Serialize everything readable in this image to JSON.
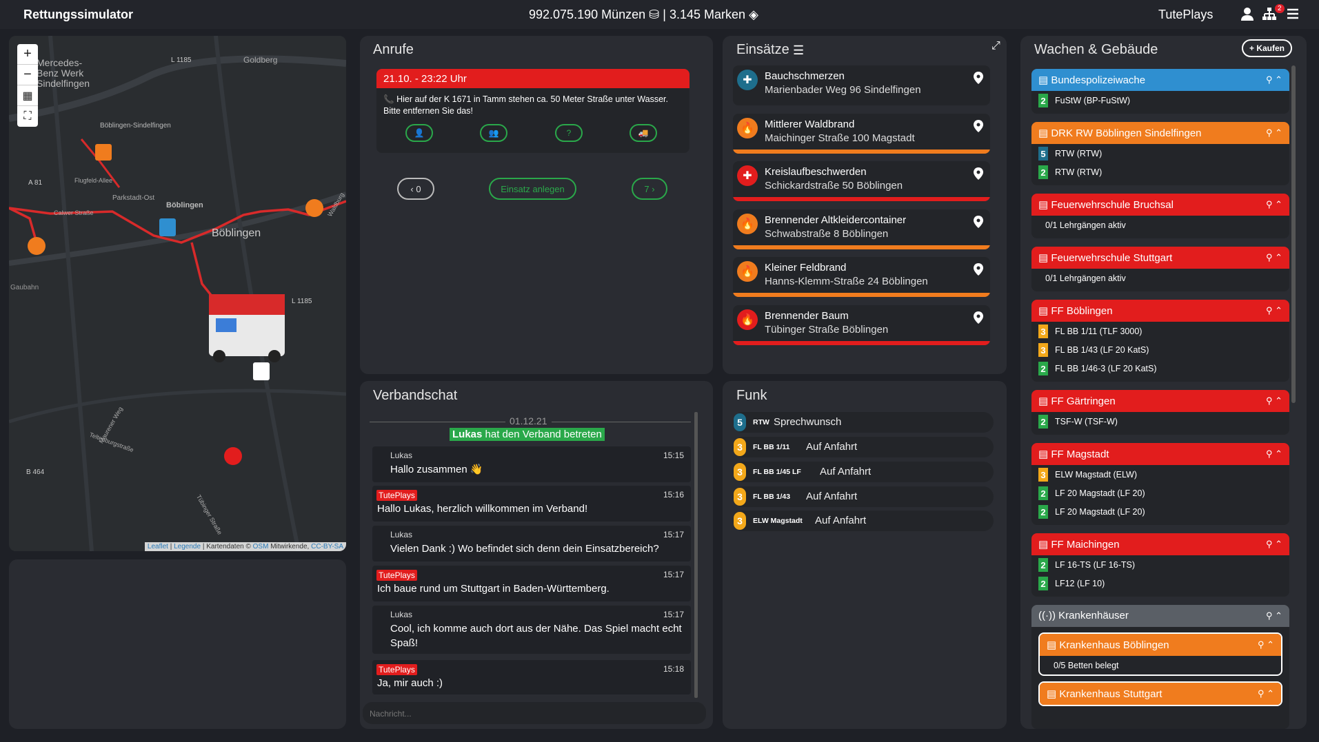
{
  "app": {
    "title": "Rettungssimulator",
    "currency": "992.075.190 Münzen",
    "separator": "|",
    "marks": "3.145 Marken",
    "user": "TutePlays",
    "notifications": "2"
  },
  "map": {
    "labels": [
      "Mercedes-",
      "Benz Werk",
      "Sindelfingen",
      "L 1185",
      "Goldberg",
      "Böblingen-Sindelfingen",
      "A 81",
      "Flugfeld-Allee",
      "Parkstadt-Ost",
      "Böblingen",
      "Calwer Straße",
      "Böblingen",
      "L 1185",
      "Gaubahn",
      "Waldburg",
      "Maurener Weg",
      "Teltenburgstraße",
      "B 464",
      "Tübinger Straße"
    ],
    "attribution": {
      "leaflet": "Leaflet",
      "legend": "Legende",
      "data": "Kartendaten ©",
      "osm": "OSM",
      "contrib": "Mitwirkende,",
      "license": "CC-BY-SA",
      "sep": "|"
    },
    "zoom_in": "+",
    "zoom_out": "−"
  },
  "calls": {
    "title": "Anrufe",
    "current": {
      "time": "21.10. - 23:22 Uhr",
      "text": "Hier auf der K 1671 in Tamm stehen ca. 50 Meter Straße unter Wasser. Bitte entfernen Sie das!"
    },
    "prev": "‹ 0",
    "create": "Einsatz anlegen",
    "next": "7 ›"
  },
  "missions": {
    "title": "Einsätze",
    "items": [
      {
        "name": "Bauchschmerzen",
        "address": "Marienbader Weg 96 Sindelfingen",
        "color": "#1e6e8c",
        "bar": ""
      },
      {
        "name": "Mittlerer Waldbrand",
        "address": "Maichinger Straße 100 Magstadt",
        "color": "#f07c1e",
        "bar": "#f07c1e"
      },
      {
        "name": "Kreislaufbeschwerden",
        "address": "Schickardstraße 50 Böblingen",
        "color": "#e21d1d",
        "bar": "#e21d1d"
      },
      {
        "name": "Brennender Altkleidercontainer",
        "address": "Schwabstraße 8 Böblingen",
        "color": "#f07c1e",
        "bar": "#f07c1e"
      },
      {
        "name": "Kleiner Feldbrand",
        "address": "Hanns-Klemm-Straße 24 Böblingen",
        "color": "#f07c1e",
        "bar": "#f07c1e"
      },
      {
        "name": "Brennender Baum",
        "address": "Tübinger Straße Böblingen",
        "color": "#e21d1d",
        "bar": "#e21d1d"
      }
    ]
  },
  "chat": {
    "title": "Verbandschat",
    "date": "01.12.21",
    "join_name": "Lukas",
    "join_text": "hat den Verband betreten",
    "messages": [
      {
        "user": "Lukas",
        "time": "15:15",
        "text": "Hallo zusammen 👋"
      },
      {
        "user": "TutePlays",
        "time": "15:16",
        "text": "Hallo Lukas, herzlich willkommen im Verband!"
      },
      {
        "user": "Lukas",
        "time": "15:17",
        "text": "Vielen Dank :) Wo befindet sich denn dein Einsatzbereich?"
      },
      {
        "user": "TutePlays",
        "time": "15:17",
        "text": "Ich baue rund um Stuttgart in Baden-Württemberg."
      },
      {
        "user": "Lukas",
        "time": "15:17",
        "text": "Cool, ich komme auch dort aus der Nähe. Das Spiel macht echt Spaß!"
      },
      {
        "user": "TutePlays",
        "time": "15:18",
        "text": "Ja, mir auch :)"
      }
    ],
    "placeholder": "Nachricht..."
  },
  "funk": {
    "title": "Funk",
    "items": [
      {
        "status": "5",
        "color": "#1e6e8c",
        "vehicle": "RTW",
        "message": "Sprechwunsch"
      },
      {
        "status": "3",
        "color": "#f3a81a",
        "vehicle": "FL BB 1/11",
        "message": "Auf Anfahrt"
      },
      {
        "status": "3",
        "color": "#f3a81a",
        "vehicle": "FL BB 1/45 LF",
        "message": "Auf Anfahrt"
      },
      {
        "status": "3",
        "color": "#f3a81a",
        "vehicle": "FL BB 1/43",
        "message": "Auf Anfahrt"
      },
      {
        "status": "3",
        "color": "#f3a81a",
        "vehicle": "ELW Magstadt",
        "message": "Auf Anfahrt"
      }
    ]
  },
  "stations": {
    "title": "Wachen & Gebäude",
    "buy": "+ Kaufen",
    "items": [
      {
        "name": "Bundespolizeiwache",
        "color": "#2f8fd0",
        "lines": [
          {
            "status": "2",
            "text": "FuStW (BP-FuStW)"
          }
        ]
      },
      {
        "name": "DRK RW Böblingen Sindelfingen",
        "color": "#f07c1e",
        "lines": [
          {
            "status": "5",
            "text": "RTW (RTW)"
          },
          {
            "status": "2",
            "text": "RTW (RTW)"
          }
        ]
      },
      {
        "name": "Feuerwehrschule Bruchsal",
        "color": "#e21d1d",
        "lines": [
          {
            "status": "",
            "text": "0/1 Lehrgängen aktiv"
          }
        ]
      },
      {
        "name": "Feuerwehrschule Stuttgart",
        "color": "#e21d1d",
        "lines": [
          {
            "status": "",
            "text": "0/1 Lehrgängen aktiv"
          }
        ]
      },
      {
        "name": "FF Böblingen",
        "color": "#e21d1d",
        "lines": [
          {
            "status": "3",
            "text": "FL BB 1/11 (TLF 3000)"
          },
          {
            "status": "3",
            "text": "FL BB 1/43 (LF 20 KatS)"
          },
          {
            "status": "2",
            "text": "FL BB 1/46-3 (LF 20 KatS)"
          }
        ]
      },
      {
        "name": "FF Gärtringen",
        "color": "#e21d1d",
        "lines": [
          {
            "status": "2",
            "text": "TSF-W (TSF-W)"
          }
        ]
      },
      {
        "name": "FF Magstadt",
        "color": "#e21d1d",
        "lines": [
          {
            "status": "3",
            "text": "ELW Magstadt (ELW)"
          },
          {
            "status": "2",
            "text": "LF 20 Magstadt (LF 20)"
          },
          {
            "status": "2",
            "text": "LF 20 Magstadt (LF 20)"
          }
        ]
      },
      {
        "name": "FF Maichingen",
        "color": "#e21d1d",
        "lines": [
          {
            "status": "2",
            "text": "LF 16-TS (LF 16-TS)"
          },
          {
            "status": "2",
            "text": "LF12 (LF 10)"
          }
        ]
      }
    ],
    "hospitals": {
      "name": "Krankenhäuser",
      "color": "#5a5f66",
      "items": [
        {
          "name": "Krankenhaus Böblingen",
          "beds": "0/5 Betten belegt"
        },
        {
          "name": "Krankenhaus Stuttgart"
        }
      ]
    },
    "status_colors": {
      "2": "#2aa84a",
      "3": "#f3a81a",
      "5": "#1e6e8c"
    }
  }
}
